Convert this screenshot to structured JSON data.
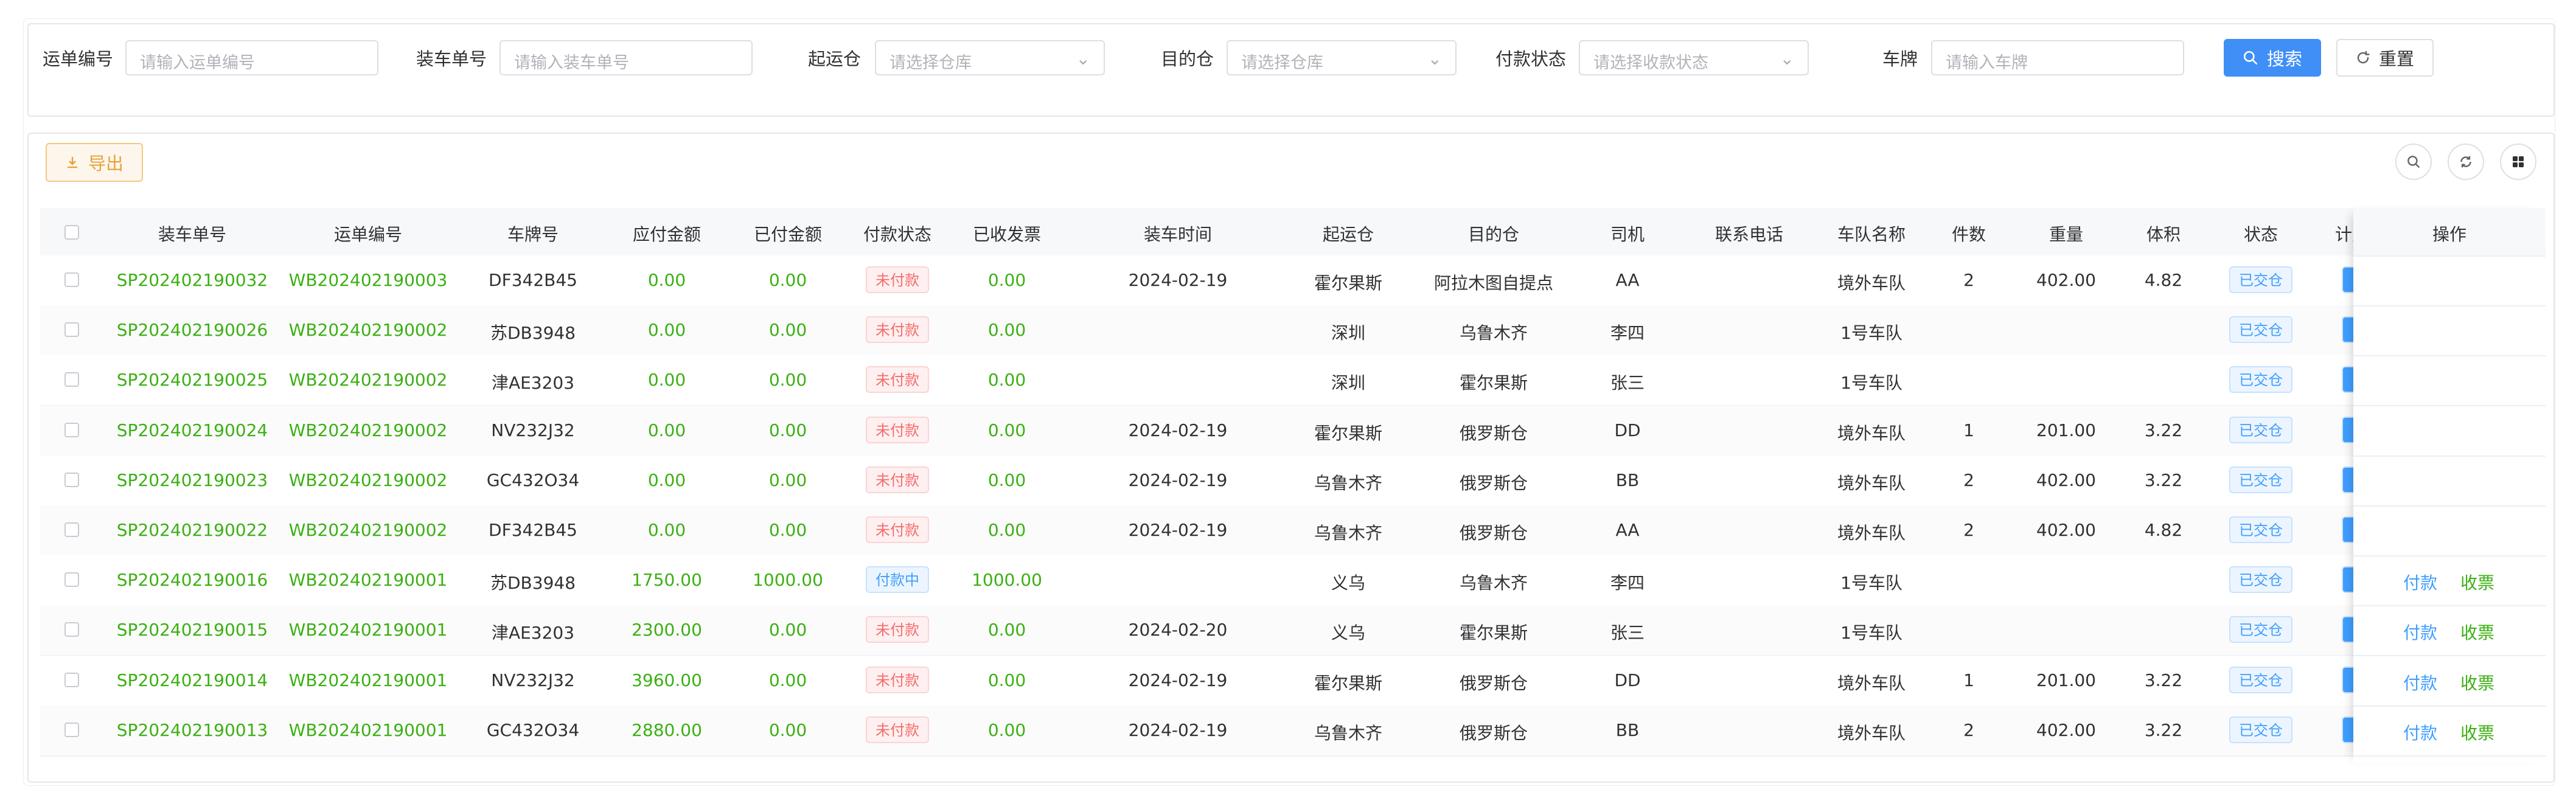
{
  "search": {
    "waybill_label": "运单编号",
    "waybill_placeholder": "请输入运单编号",
    "loading_label": "装车单号",
    "loading_placeholder": "请输入装车单号",
    "origin_label": "起运仓",
    "origin_placeholder": "请选择仓库",
    "dest_label": "目的仓",
    "dest_placeholder": "请选择仓库",
    "pay_status_label": "付款状态",
    "pay_status_placeholder": "请选择收款状态",
    "plate_label": "车牌",
    "plate_placeholder": "请输入车牌",
    "search_button": "搜索",
    "reset_button": "重置"
  },
  "toolbar": {
    "export_button": "导出"
  },
  "columns": [
    "装车单号",
    "运单编号",
    "车牌号",
    "应付金额",
    "已付金额",
    "付款状态",
    "已收发票",
    "装车时间",
    "起运仓",
    "目的仓",
    "司机",
    "联系电话",
    "车队名称",
    "件数",
    "重量",
    "体积",
    "状态",
    "计费"
  ],
  "operation_header": "操作",
  "rows": [
    {
      "loading_no": "SP202402190032",
      "waybill": "WB202402190003",
      "plate": "DF342B45",
      "payable": "0.00",
      "paid": "0.00",
      "pay_status": "未付款",
      "invoice": "0.00",
      "load_time": "2024-02-19",
      "origin": "霍尔果斯",
      "dest": "阿拉木图自提点",
      "driver": "AA",
      "phone": "",
      "fleet": "境外车队",
      "pieces": "2",
      "weight": "402.00",
      "volume": "4.82",
      "status": "已交仓",
      "ops": []
    },
    {
      "loading_no": "SP202402190026",
      "waybill": "WB202402190002",
      "plate": "苏DB3948",
      "payable": "0.00",
      "paid": "0.00",
      "pay_status": "未付款",
      "invoice": "0.00",
      "load_time": "",
      "origin": "深圳",
      "dest": "乌鲁木齐",
      "driver": "李四",
      "phone": "",
      "fleet": "1号车队",
      "pieces": "",
      "weight": "",
      "volume": "",
      "status": "已交仓",
      "ops": []
    },
    {
      "loading_no": "SP202402190025",
      "waybill": "WB202402190002",
      "plate": "津AE3203",
      "payable": "0.00",
      "paid": "0.00",
      "pay_status": "未付款",
      "invoice": "0.00",
      "load_time": "",
      "origin": "深圳",
      "dest": "霍尔果斯",
      "driver": "张三",
      "phone": "",
      "fleet": "1号车队",
      "pieces": "",
      "weight": "",
      "volume": "",
      "status": "已交仓",
      "ops": []
    },
    {
      "loading_no": "SP202402190024",
      "waybill": "WB202402190002",
      "plate": "NV232J32",
      "payable": "0.00",
      "paid": "0.00",
      "pay_status": "未付款",
      "invoice": "0.00",
      "load_time": "2024-02-19",
      "origin": "霍尔果斯",
      "dest": "俄罗斯仓",
      "driver": "DD",
      "phone": "",
      "fleet": "境外车队",
      "pieces": "1",
      "weight": "201.00",
      "volume": "3.22",
      "status": "已交仓",
      "ops": []
    },
    {
      "loading_no": "SP202402190023",
      "waybill": "WB202402190002",
      "plate": "GC432O34",
      "payable": "0.00",
      "paid": "0.00",
      "pay_status": "未付款",
      "invoice": "0.00",
      "load_time": "2024-02-19",
      "origin": "乌鲁木齐",
      "dest": "俄罗斯仓",
      "driver": "BB",
      "phone": "",
      "fleet": "境外车队",
      "pieces": "2",
      "weight": "402.00",
      "volume": "3.22",
      "status": "已交仓",
      "ops": []
    },
    {
      "loading_no": "SP202402190022",
      "waybill": "WB202402190002",
      "plate": "DF342B45",
      "payable": "0.00",
      "paid": "0.00",
      "pay_status": "未付款",
      "invoice": "0.00",
      "load_time": "2024-02-19",
      "origin": "乌鲁木齐",
      "dest": "俄罗斯仓",
      "driver": "AA",
      "phone": "",
      "fleet": "境外车队",
      "pieces": "2",
      "weight": "402.00",
      "volume": "4.82",
      "status": "已交仓",
      "ops": []
    },
    {
      "loading_no": "SP202402190016",
      "waybill": "WB202402190001",
      "plate": "苏DB3948",
      "payable": "1750.00",
      "paid": "1000.00",
      "pay_status": "付款中",
      "invoice": "1000.00",
      "load_time": "",
      "origin": "义乌",
      "dest": "乌鲁木齐",
      "driver": "李四",
      "phone": "",
      "fleet": "1号车队",
      "pieces": "",
      "weight": "",
      "volume": "",
      "status": "已交仓",
      "ops": [
        "付款",
        "收票"
      ]
    },
    {
      "loading_no": "SP202402190015",
      "waybill": "WB202402190001",
      "plate": "津AE3203",
      "payable": "2300.00",
      "paid": "0.00",
      "pay_status": "未付款",
      "invoice": "0.00",
      "load_time": "2024-02-20",
      "origin": "义乌",
      "dest": "霍尔果斯",
      "driver": "张三",
      "phone": "",
      "fleet": "1号车队",
      "pieces": "",
      "weight": "",
      "volume": "",
      "status": "已交仓",
      "ops": [
        "付款",
        "收票"
      ]
    },
    {
      "loading_no": "SP202402190014",
      "waybill": "WB202402190001",
      "plate": "NV232J32",
      "payable": "3960.00",
      "paid": "0.00",
      "pay_status": "未付款",
      "invoice": "0.00",
      "load_time": "2024-02-19",
      "origin": "霍尔果斯",
      "dest": "俄罗斯仓",
      "driver": "DD",
      "phone": "",
      "fleet": "境外车队",
      "pieces": "1",
      "weight": "201.00",
      "volume": "3.22",
      "status": "已交仓",
      "ops": [
        "付款",
        "收票"
      ]
    },
    {
      "loading_no": "SP202402190013",
      "waybill": "WB202402190001",
      "plate": "GC432O34",
      "payable": "2880.00",
      "paid": "0.00",
      "pay_status": "未付款",
      "invoice": "0.00",
      "load_time": "2024-02-19",
      "origin": "乌鲁木齐",
      "dest": "俄罗斯仓",
      "driver": "BB",
      "phone": "",
      "fleet": "境外车队",
      "pieces": "2",
      "weight": "402.00",
      "volume": "3.22",
      "status": "已交仓",
      "ops": [
        "付款",
        "收票"
      ]
    }
  ]
}
